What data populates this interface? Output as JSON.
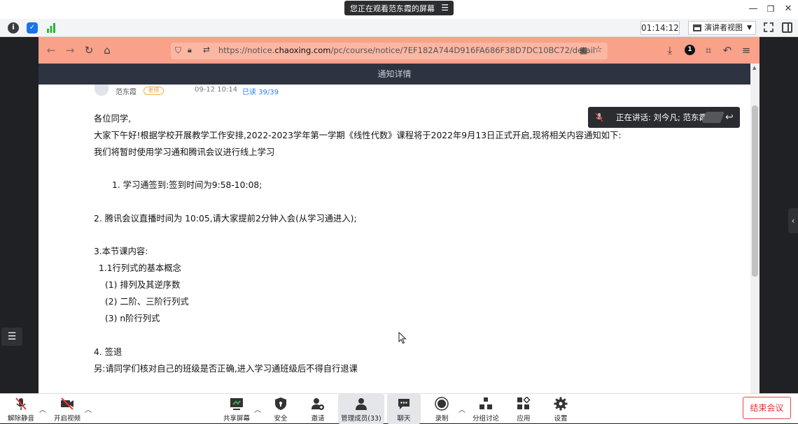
{
  "top_bar": {
    "share_banner": "您正在观看范东霞的屏幕",
    "banner_menu_icon": "menu-icon"
  },
  "meeting_row": {
    "timer": "01:14:12",
    "presenter_view": "演讲者视图"
  },
  "browser": {
    "url_prefix": "https://notice.",
    "url_host": "chaoxing.com",
    "url_rest": "/pc/course/notice/7EF182A744D916FA686F38D7DC10BC72/detail",
    "page_title": "通知详情",
    "toolbar_badge": "1"
  },
  "notice": {
    "author": "范东霞",
    "role_tag": "老师",
    "date": "09-12 10:14",
    "read_status": "已读 39/39",
    "lines": [
      "各位同学,",
      "大家下午好!根据学校开展教学工作安排,2022-2023学年第一学期《线性代数》课程将于2022年9月13日正式开启,现将相关内容通知如下:",
      "我们将暂时使用学习通和腾讯会议进行线上学习",
      "1. 学习通签到:签到时间为9:58-10:08;",
      "2. 腾讯会议直播时间为 10:05,请大家提前2分钟入会(从学习通进入);",
      "3.本节课内容:",
      "1.1行列式的基本概念",
      "(1) 排列及其逆序数",
      "(2) 二阶、三阶行列式",
      "(3) n阶行列式",
      "4. 签退",
      "另:请同学们核对自己的班级是否正确,进入学习通班级后不得自行退课"
    ]
  },
  "speaking": {
    "text": "正在讲话: 刘今凡; 范东霞;"
  },
  "bottom_bar": {
    "unmute": "解除静音",
    "video": "开启视频",
    "share": "共享屏幕",
    "security": "安全",
    "invite": "邀请",
    "members": "管理成员(33)",
    "chat": "聊天",
    "record": "录制",
    "breakout": "分组讨论",
    "apps": "应用",
    "settings": "设置",
    "end_meeting": "结束会议"
  },
  "colors": {
    "browser_toolbar": "#f9a189",
    "page_header": "#2d3340",
    "end_meeting_red": "#e03131",
    "shield_blue": "#1a73e8",
    "signal_green": "#2fb344"
  }
}
